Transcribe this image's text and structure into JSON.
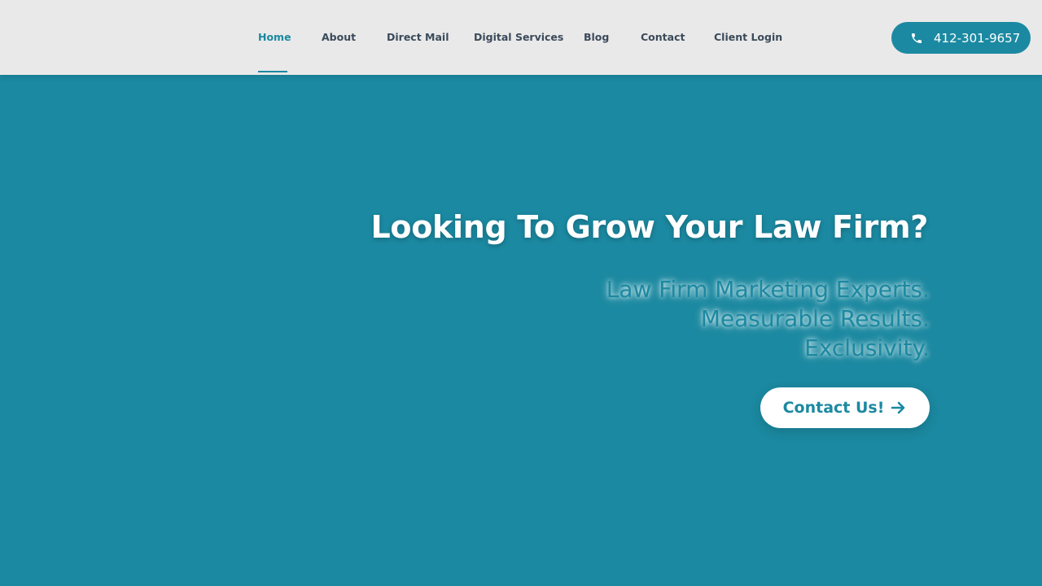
{
  "nav": {
    "items": [
      {
        "label": "Home",
        "active": true
      },
      {
        "label": "About"
      },
      {
        "label": "Direct Mail"
      },
      {
        "label": "Digital Services"
      },
      {
        "label": "Blog"
      },
      {
        "label": "Contact"
      },
      {
        "label": "Client Login"
      }
    ],
    "phone": "412-301-9657",
    "phone_icon": "phone-icon"
  },
  "hero": {
    "headline": "Looking To Grow Your Law Firm?",
    "lines": [
      "Law Firm Marketing Experts.",
      "Measurable Results.",
      "Exclusivity."
    ],
    "cta_label": "Contact Us!",
    "cta_icon": "arrow-right-icon"
  },
  "colors": {
    "brand": "#1b89a1",
    "header_bg": "#e9e9e9",
    "nav_text": "#3b4a5a"
  }
}
